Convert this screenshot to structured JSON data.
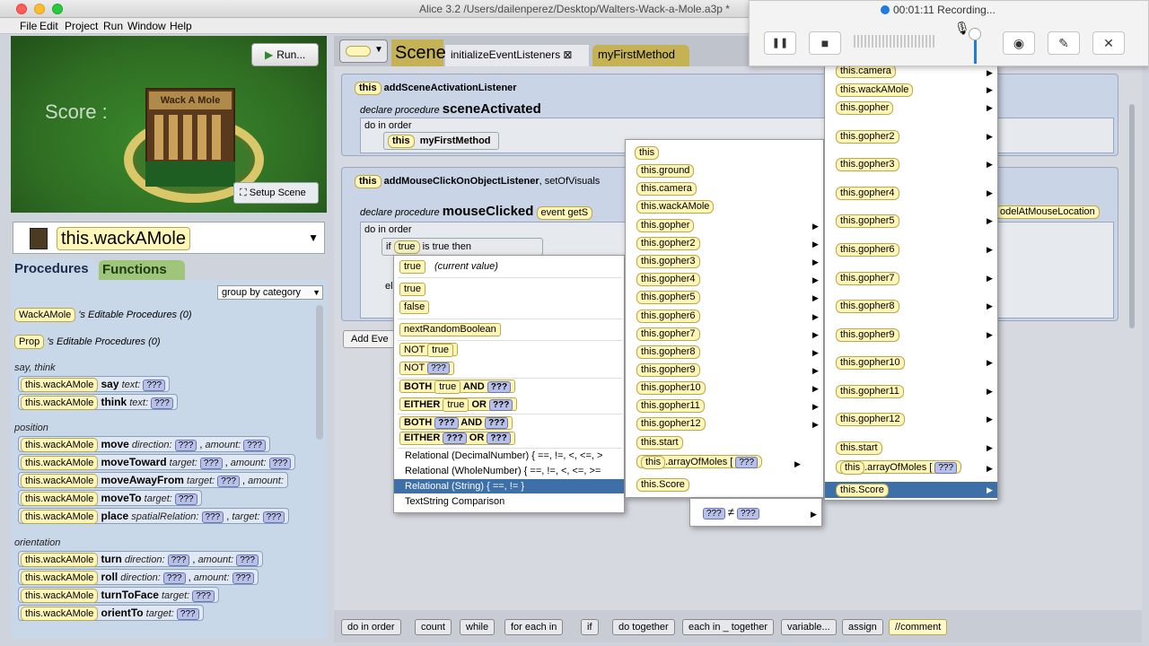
{
  "window": {
    "title": "Alice  3.2 /Users/dailenperez/Desktop/Walters-Wack-a-Mole.a3p *"
  },
  "menubar": [
    "File",
    "Edit",
    "Project",
    "Run",
    "Window",
    "Help"
  ],
  "scene": {
    "run_label": "Run...",
    "setup_label": "Setup Scene",
    "score_ghost": "Score :",
    "sign": "Wack A Mole"
  },
  "selector": {
    "selected": "this.wackAMole"
  },
  "left_tabs": {
    "procedures": "Procedures",
    "functions": "Functions"
  },
  "groupby": "group by category",
  "editable": [
    {
      "chip": "WackAMole",
      "text": "'s Editable Procedures (0)"
    },
    {
      "chip": "Prop",
      "text": "'s Editable Procedures (0)"
    }
  ],
  "sections": {
    "say": "say, think",
    "position": "position",
    "orientation": "orientation"
  },
  "procedures": [
    {
      "obj": "this.wackAMole",
      "name": "say",
      "params": "text:",
      "p2": ""
    },
    {
      "obj": "this.wackAMole",
      "name": "think",
      "params": "text:",
      "p2": ""
    },
    {
      "obj": "this.wackAMole",
      "name": "move",
      "params": "direction:",
      "p2": "amount:"
    },
    {
      "obj": "this.wackAMole",
      "name": "moveToward",
      "params": "target:",
      "p2": "amount:"
    },
    {
      "obj": "this.wackAMole",
      "name": "moveAwayFrom",
      "params": "target:",
      "p2": "amount:"
    },
    {
      "obj": "this.wackAMole",
      "name": "moveTo",
      "params": "target:",
      "p2": ""
    },
    {
      "obj": "this.wackAMole",
      "name": "place",
      "params": "spatialRelation:",
      "p2": "target:"
    },
    {
      "obj": "this.wackAMole",
      "name": "turn",
      "params": "direction:",
      "p2": "amount:"
    },
    {
      "obj": "this.wackAMole",
      "name": "roll",
      "params": "direction:",
      "p2": "amount:"
    },
    {
      "obj": "this.wackAMole",
      "name": "turnToFace",
      "params": "target:",
      "p2": ""
    },
    {
      "obj": "this.wackAMole",
      "name": "orientTo",
      "params": "target:",
      "p2": ""
    }
  ],
  "qmark": "???",
  "editor_tabs": {
    "scene": "Scene",
    "init": "initializeEventListeners",
    "first": "myFirstMethod",
    "close": "⊠"
  },
  "event1": {
    "this": "this",
    "head": "addSceneActivationListener",
    "declare": "declare procedure",
    "proc": "sceneActivated",
    "doorder": "do in order",
    "stmt": "myFirstMethod"
  },
  "event2": {
    "this": "this",
    "head": "addMouseClickOnObjectListener",
    "extra": ", setOfVisuals",
    "declare": "declare procedure",
    "proc": "mouseClicked",
    "event": "event",
    "event_get": "getS",
    "model": "odelAtMouseLocation",
    "doorder": "do in order",
    "if": "if",
    "cond": "true",
    "then": "is true then",
    "else": "el"
  },
  "add_event": "Add Eve",
  "menu1": {
    "items": [
      {
        "chip": "true",
        "text": "(current value)"
      },
      {
        "chip": "true",
        "text": ""
      },
      {
        "chip": "false",
        "text": ""
      },
      {
        "chip": "nextRandomBoolean",
        "text": ""
      },
      {
        "pre": "NOT",
        "chip": "true",
        "text": ""
      },
      {
        "pre": "NOT",
        "chip": "???",
        "text": ""
      }
    ],
    "both1": {
      "a": "BOTH",
      "b": "true",
      "c": "AND",
      "d": "???"
    },
    "either1": {
      "a": "EITHER",
      "b": "true",
      "c": "OR",
      "d": "???"
    },
    "both2": {
      "a": "BOTH",
      "b": "???",
      "c": "AND",
      "d": "???"
    },
    "either2": {
      "a": "EITHER",
      "b": "???",
      "c": "OR",
      "d": "???"
    },
    "relational": [
      "Relational (DecimalNumber) { ==, !=, <, <=, >",
      "Relational (WholeNumber) { ==, !=, <, <=, >=",
      "Relational (String) { ==, != }",
      "TextString Comparison"
    ]
  },
  "menu2": {
    "items": [
      "this",
      "this.ground",
      "this.camera",
      "this.wackAMole",
      "this.gopher",
      "this.gopher2",
      "this.gopher3",
      "this.gopher4",
      "this.gopher5",
      "this.gopher6",
      "this.gopher7",
      "this.gopher8",
      "this.gopher9",
      "this.gopher10",
      "this.gopher11",
      "this.gopher12",
      "this.start"
    ],
    "array": {
      "this": "this",
      "text": ".arrayOfMoles [",
      "q": "???"
    },
    "score": "this.Score"
  },
  "menu3": {
    "items": [
      "this.camera",
      "this.wackAMole",
      "this.gopher",
      "this.gopher2",
      "this.gopher3",
      "this.gopher4",
      "this.gopher5",
      "this.gopher6",
      "this.gopher7",
      "this.gopher8",
      "this.gopher9",
      "this.gopher10",
      "this.gopher11",
      "this.gopher12",
      "this.start"
    ],
    "array": {
      "this": "this",
      "text": ".arrayOfMoles [",
      "q": "???"
    },
    "score": "this.Score"
  },
  "neq": {
    "left": "???",
    "op": "≠",
    "right": "???"
  },
  "bottom": [
    "do in order",
    "count",
    "while",
    "for each in",
    "if",
    "do together",
    "each in _ together",
    "variable...",
    "assign",
    "//comment"
  ],
  "recording": {
    "title": "00:01:11 Recording...",
    "pause": "❚❚",
    "stop": "■",
    "close": "✕",
    "mic": "🎙",
    "cam": "◉",
    "pen": "✎"
  }
}
